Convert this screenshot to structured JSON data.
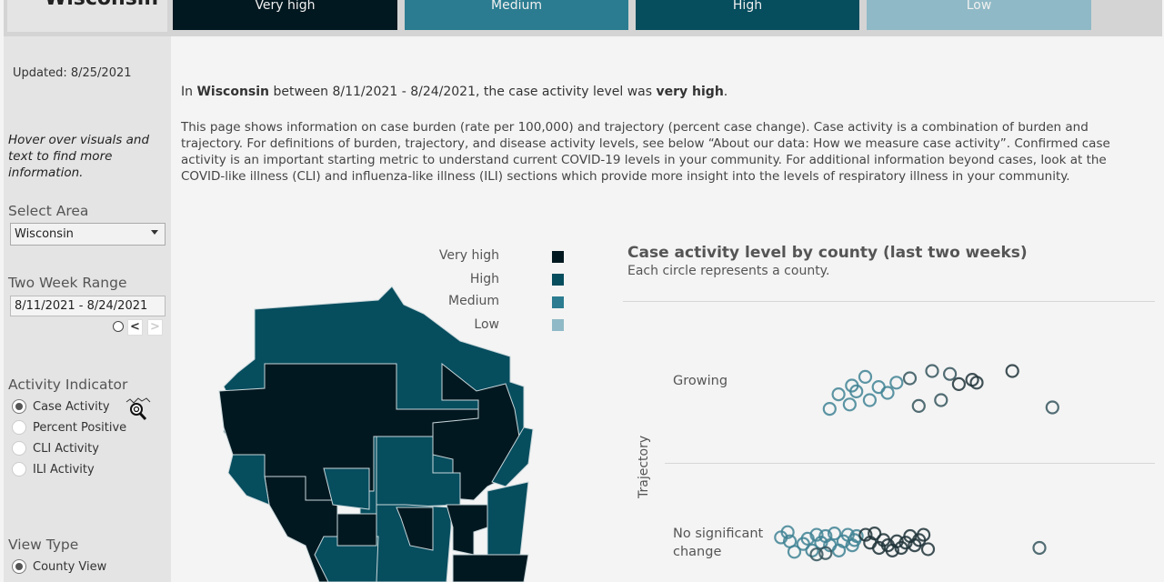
{
  "header": {
    "area_title": "Wisconsin",
    "level_buttons": [
      {
        "label": "Very high",
        "color": "#021820"
      },
      {
        "label": "Medium",
        "color": "#2b7c90"
      },
      {
        "label": "High",
        "color": "#064d5e"
      },
      {
        "label": "Low",
        "color": "#8fb9c6"
      }
    ]
  },
  "sidebar": {
    "updated": "Updated: 8/25/2021",
    "hover_note": "Hover over visuals and text to find more information.",
    "select_area": {
      "label": "Select Area",
      "value": "Wisconsin"
    },
    "two_week_range": {
      "label": "Two Week Range",
      "value": "8/11/2021 - 8/24/2021",
      "prev": "<",
      "next": ">"
    },
    "activity_indicator": {
      "label": "Activity Indicator",
      "options": [
        {
          "label": "Case Activity",
          "checked": true
        },
        {
          "label": "Percent Positive",
          "checked": false
        },
        {
          "label": "CLI Activity",
          "checked": false
        },
        {
          "label": "ILI Activity",
          "checked": false
        }
      ]
    },
    "view_type": {
      "label": "View Type",
      "options": [
        {
          "label": "County View",
          "checked": true
        }
      ]
    }
  },
  "main": {
    "summary": {
      "prefix": "In ",
      "area": "Wisconsin",
      "middle": " between 8/11/2021 - 8/24/2021, the case activity level was ",
      "level": "very high",
      "suffix": "."
    },
    "description": "This page shows information on case burden (rate per 100,000) and trajectory (percent case change). Case activity is a combination of burden and trajectory. For definitions of burden, trajectory, and disease activity levels, see below “About our data: How we measure case activity”. Confirmed case activity is an important starting metric to understand current COVID-19 levels in your community. For additional information beyond cases, look at the COVID-like illness (CLI) and influenza-like illness (ILI) sections which provide more insight into the levels of respiratory illness in your community.",
    "map_legend": [
      {
        "label": "Very high",
        "color": "#021820"
      },
      {
        "label": "High",
        "color": "#064d5e"
      },
      {
        "label": "Medium",
        "color": "#2b7c90"
      },
      {
        "label": "Low",
        "color": "#8fb9c6"
      }
    ]
  },
  "chart_data": {
    "type": "scatter",
    "title": "Case activity level by county (last two weeks)",
    "subtitle": "Each circle represents a county.",
    "ylabel": "Trajectory",
    "row_labels": [
      "Growing",
      "No significant change"
    ],
    "series": [
      {
        "name": "Growing",
        "points": [
          {
            "x": 0.35,
            "y": 0.82,
            "level": "Medium"
          },
          {
            "x": 0.29,
            "y": 0.58,
            "level": "Medium"
          },
          {
            "x": 0.32,
            "y": 0.7,
            "level": "Medium"
          },
          {
            "x": 0.33,
            "y": 0.62,
            "level": "Medium"
          },
          {
            "x": 0.36,
            "y": 0.5,
            "level": "Medium"
          },
          {
            "x": 0.4,
            "y": 0.6,
            "level": "Medium"
          },
          {
            "x": 0.38,
            "y": 0.68,
            "level": "Medium"
          },
          {
            "x": 0.42,
            "y": 0.74,
            "level": "Medium"
          },
          {
            "x": 0.45,
            "y": 0.8,
            "level": "High"
          },
          {
            "x": 0.47,
            "y": 0.42,
            "level": "High"
          },
          {
            "x": 0.5,
            "y": 0.9,
            "level": "High"
          },
          {
            "x": 0.52,
            "y": 0.5,
            "level": "High"
          },
          {
            "x": 0.54,
            "y": 0.86,
            "level": "High"
          },
          {
            "x": 0.56,
            "y": 0.72,
            "level": "Very high"
          },
          {
            "x": 0.59,
            "y": 0.78,
            "level": "Very high"
          },
          {
            "x": 0.6,
            "y": 0.74,
            "level": "Very high"
          },
          {
            "x": 0.68,
            "y": 0.9,
            "level": "Very high"
          },
          {
            "x": 0.77,
            "y": 0.4,
            "level": "High"
          },
          {
            "x": 0.27,
            "y": 0.38,
            "level": "Medium"
          },
          {
            "x": 0.315,
            "y": 0.44,
            "level": "Medium"
          }
        ]
      },
      {
        "name": "No significant change",
        "points": [
          {
            "x": 0.12,
            "y": 0.82,
            "level": "Medium"
          },
          {
            "x": 0.135,
            "y": 0.9,
            "level": "Medium"
          },
          {
            "x": 0.14,
            "y": 0.76,
            "level": "Medium"
          },
          {
            "x": 0.15,
            "y": 0.6,
            "level": "Medium"
          },
          {
            "x": 0.17,
            "y": 0.72,
            "level": "Medium"
          },
          {
            "x": 0.18,
            "y": 0.8,
            "level": "Medium"
          },
          {
            "x": 0.19,
            "y": 0.62,
            "level": "Medium"
          },
          {
            "x": 0.2,
            "y": 0.86,
            "level": "Medium"
          },
          {
            "x": 0.21,
            "y": 0.74,
            "level": "Medium"
          },
          {
            "x": 0.22,
            "y": 0.84,
            "level": "Medium"
          },
          {
            "x": 0.23,
            "y": 0.7,
            "level": "Medium"
          },
          {
            "x": 0.24,
            "y": 0.88,
            "level": "Medium"
          },
          {
            "x": 0.25,
            "y": 0.62,
            "level": "Medium"
          },
          {
            "x": 0.26,
            "y": 0.76,
            "level": "Medium"
          },
          {
            "x": 0.27,
            "y": 0.86,
            "level": "Medium"
          },
          {
            "x": 0.28,
            "y": 0.7,
            "level": "Medium"
          },
          {
            "x": 0.285,
            "y": 0.78,
            "level": "Medium"
          },
          {
            "x": 0.29,
            "y": 0.84,
            "level": "Medium"
          },
          {
            "x": 0.2,
            "y": 0.56,
            "level": "High"
          },
          {
            "x": 0.22,
            "y": 0.58,
            "level": "High"
          },
          {
            "x": 0.31,
            "y": 0.86,
            "level": "Very high"
          },
          {
            "x": 0.32,
            "y": 0.74,
            "level": "Very high"
          },
          {
            "x": 0.33,
            "y": 0.88,
            "level": "Very high"
          },
          {
            "x": 0.34,
            "y": 0.66,
            "level": "Very high"
          },
          {
            "x": 0.35,
            "y": 0.78,
            "level": "Very high"
          },
          {
            "x": 0.36,
            "y": 0.7,
            "level": "Very high"
          },
          {
            "x": 0.37,
            "y": 0.62,
            "level": "Very high"
          },
          {
            "x": 0.38,
            "y": 0.76,
            "level": "Very high"
          },
          {
            "x": 0.39,
            "y": 0.66,
            "level": "Very high"
          },
          {
            "x": 0.4,
            "y": 0.74,
            "level": "Very high"
          },
          {
            "x": 0.41,
            "y": 0.84,
            "level": "Very high"
          },
          {
            "x": 0.42,
            "y": 0.7,
            "level": "Very high"
          },
          {
            "x": 0.43,
            "y": 0.78,
            "level": "Very high"
          },
          {
            "x": 0.44,
            "y": 0.86,
            "level": "Very high"
          },
          {
            "x": 0.45,
            "y": 0.64,
            "level": "Very high"
          },
          {
            "x": 0.7,
            "y": 0.66,
            "level": "High"
          }
        ]
      }
    ]
  }
}
